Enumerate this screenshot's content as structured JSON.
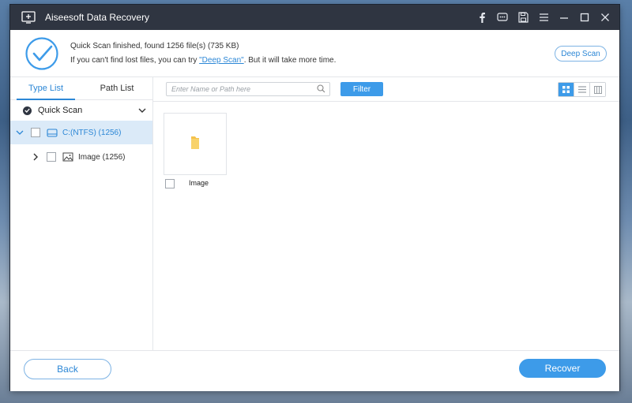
{
  "app": {
    "title": "Aiseesoft Data Recovery",
    "title_icons": [
      "facebook-icon",
      "chat-icon",
      "save-icon",
      "menu-icon",
      "minimize-icon",
      "maximize-icon",
      "close-icon"
    ]
  },
  "status": {
    "line1": "Quick Scan finished, found 1256 file(s) (735 KB)",
    "line2_prefix": "If you can't find lost files, you can try ",
    "line2_link": "\"Deep Scan\"",
    "line2_suffix": ". But it will take more time.",
    "deep_scan_label": "Deep Scan"
  },
  "sidebar": {
    "tabs": [
      {
        "label": "Type List",
        "active": true
      },
      {
        "label": "Path List",
        "active": false
      }
    ],
    "quick_scan_label": "Quick Scan",
    "tree": [
      {
        "label": "C:(NTFS) (1256)",
        "selected": true,
        "expanded": true
      },
      {
        "label": "Image (1256)",
        "selected": false,
        "expanded": false
      }
    ]
  },
  "toolbar": {
    "search_placeholder": "Enter Name or Path here",
    "filter_label": "Filter",
    "view_modes": [
      "grid-view-icon",
      "list-view-icon",
      "detail-view-icon"
    ],
    "active_view": "grid-view-icon"
  },
  "files": [
    {
      "label": "Image",
      "icon": "folder-icon"
    }
  ],
  "footer": {
    "back_label": "Back",
    "recover_label": "Recover"
  },
  "colors": {
    "accent": "#3d9be9",
    "titlebar": "#2f3541",
    "link": "#2c87d6",
    "folder": "#f5c24b"
  }
}
